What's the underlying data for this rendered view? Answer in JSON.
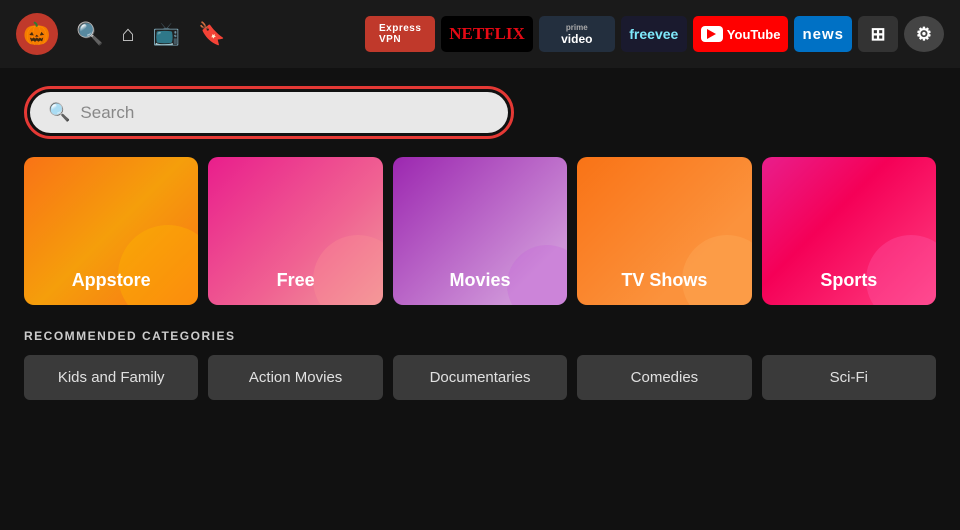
{
  "nav": {
    "avatar_emoji": "🎃",
    "icons": {
      "search": "🔍",
      "home": "⌂",
      "tv": "📺",
      "bookmark": "🔖"
    },
    "services": [
      {
        "id": "expressvpn",
        "label": "Express VPN"
      },
      {
        "id": "netflix",
        "label": "NETFLIX"
      },
      {
        "id": "prime",
        "label": "prime video"
      },
      {
        "id": "freevee",
        "label": "freevee"
      },
      {
        "id": "youtube",
        "label": "YouTube"
      },
      {
        "id": "news",
        "label": "news"
      },
      {
        "id": "grid",
        "label": "⊞"
      },
      {
        "id": "gear",
        "label": "⚙"
      }
    ]
  },
  "search": {
    "placeholder": "Search"
  },
  "tiles": [
    {
      "id": "appstore",
      "label": "Appstore"
    },
    {
      "id": "free",
      "label": "Free"
    },
    {
      "id": "movies",
      "label": "Movies"
    },
    {
      "id": "tvshows",
      "label": "TV Shows"
    },
    {
      "id": "sports",
      "label": "Sports"
    }
  ],
  "recommended": {
    "section_title": "RECOMMENDED CATEGORIES",
    "chips": [
      {
        "id": "kids",
        "label": "Kids and Family"
      },
      {
        "id": "action",
        "label": "Action Movies"
      },
      {
        "id": "docs",
        "label": "Documentaries"
      },
      {
        "id": "comedies",
        "label": "Comedies"
      },
      {
        "id": "scifi",
        "label": "Sci-Fi"
      }
    ]
  }
}
